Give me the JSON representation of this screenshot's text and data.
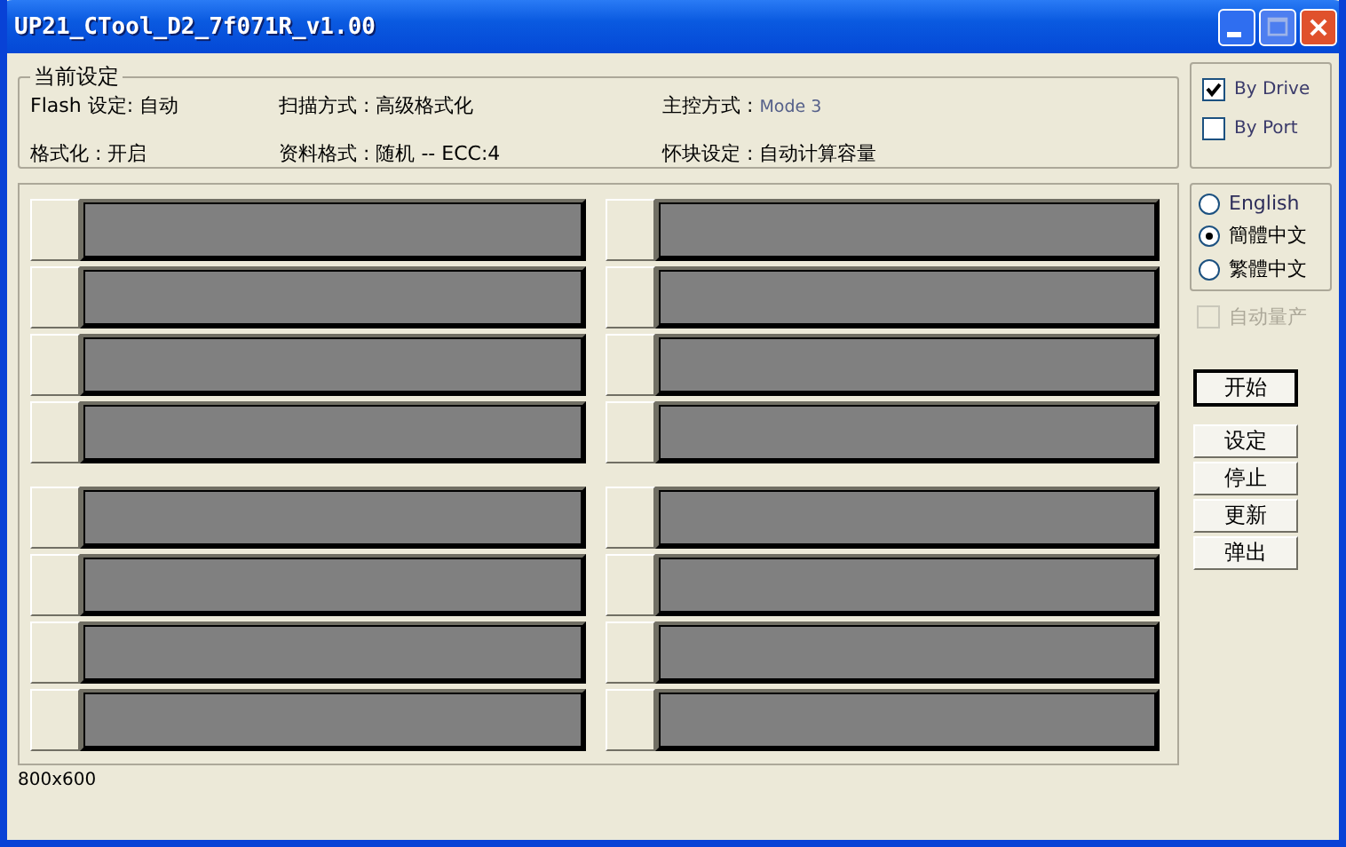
{
  "window": {
    "title": "UP21_CTool_D2_7f071R_v1.00"
  },
  "settings": {
    "title": "当前设定",
    "items": [
      {
        "label": "Flash 设定:",
        "value": "自动",
        "kind": "plain"
      },
      {
        "label": "扫描方式 :",
        "value": "高级格式化",
        "kind": "plain"
      },
      {
        "label": "主控方式 :",
        "value": "Mode 3",
        "kind": "dim"
      },
      {
        "label": "格式化 :",
        "value": "开启",
        "kind": "plain"
      },
      {
        "label": "资料格式 :",
        "value": "随机 -- ECC:4",
        "kind": "plain"
      },
      {
        "label": "怀块设定 :",
        "value": "自动计算容量",
        "kind": "plain"
      }
    ]
  },
  "port_blocks": [
    {
      "columns": [
        [
          {
            "kind": "empty"
          },
          {
            "kind": "empty"
          },
          {
            "kind": "empty"
          },
          {
            "kind": "empty"
          }
        ],
        [
          {
            "kind": "empty"
          },
          {
            "kind": "empty"
          },
          {
            "kind": "empty"
          },
          {
            "kind": "empty"
          }
        ]
      ]
    },
    {
      "columns": [
        [
          {
            "kind": "empty"
          },
          {
            "kind": "empty"
          },
          {
            "kind": "empty"
          },
          {
            "kind": "empty"
          }
        ],
        [
          {
            "kind": "empty"
          },
          {
            "kind": "empty"
          },
          {
            "kind": "empty"
          },
          {
            "kind": "empty"
          }
        ]
      ]
    }
  ],
  "mode": [
    {
      "label": "By Drive",
      "checked": true
    },
    {
      "label": "By Port",
      "checked": false
    }
  ],
  "language": [
    {
      "label": "English",
      "selected": false
    },
    {
      "label": "簡體中文",
      "selected": true
    },
    {
      "label": "繁體中文",
      "selected": false
    }
  ],
  "auto_produce": {
    "label": "自动量产",
    "checked": false,
    "disabled": true
  },
  "buttons": [
    {
      "label": "开始",
      "default": true
    },
    {
      "label": "设定",
      "default": false
    },
    {
      "label": "停止",
      "default": false
    },
    {
      "label": "更新",
      "default": false
    },
    {
      "label": "弹出",
      "default": false
    }
  ],
  "status_bar": "800x600"
}
